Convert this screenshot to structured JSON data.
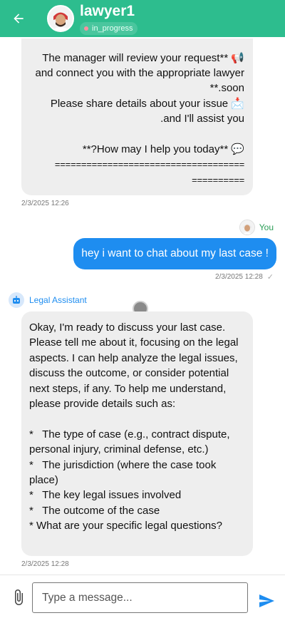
{
  "header": {
    "title": "lawyer1",
    "status": "in_progress",
    "back_icon": "arrow-left-icon"
  },
  "messages": [
    {
      "sender": "assistant",
      "lines": [
        "The manager will review your request** 📢",
        "and connect you with the appropriate lawyer",
        "**.soon",
        "Please share details about your issue 📩",
        ".and I'll assist you",
        "",
        "**?How may I help you today** 💬",
        "====================================",
        "=========="
      ],
      "timestamp": "2/3/2025 12:26"
    },
    {
      "sender": "user",
      "sender_label": "You",
      "text": "hey i want to chat about my last case !",
      "timestamp": "2/3/2025 12:28",
      "status_icon": "✓"
    },
    {
      "sender": "assistant",
      "sender_label": "Legal Assistant",
      "text": "Okay, I'm ready to discuss your last case.\nPlease tell me about it, focusing on the legal\naspects. I can help analyze the legal issues,\ndiscuss the outcome, or consider potential\nnext steps, if any. To help me understand,\nplease provide details such as:\n\n*   The type of case (e.g., contract dispute,\npersonal injury, criminal defense, etc.)\n*   The jurisdiction (where the case took\nplace)\n*   The key legal issues involved\n*   The outcome of the case\n* What are your specific legal questions?",
      "timestamp": "2/3/2025 12:28"
    }
  ],
  "composer": {
    "placeholder": "Type a message...",
    "attach_icon": "paperclip-icon",
    "send_icon": "send-icon"
  },
  "colors": {
    "header": "#2dbd8e",
    "user_bubble": "#1e8df0",
    "assistant_bubble": "#eeeeee"
  }
}
